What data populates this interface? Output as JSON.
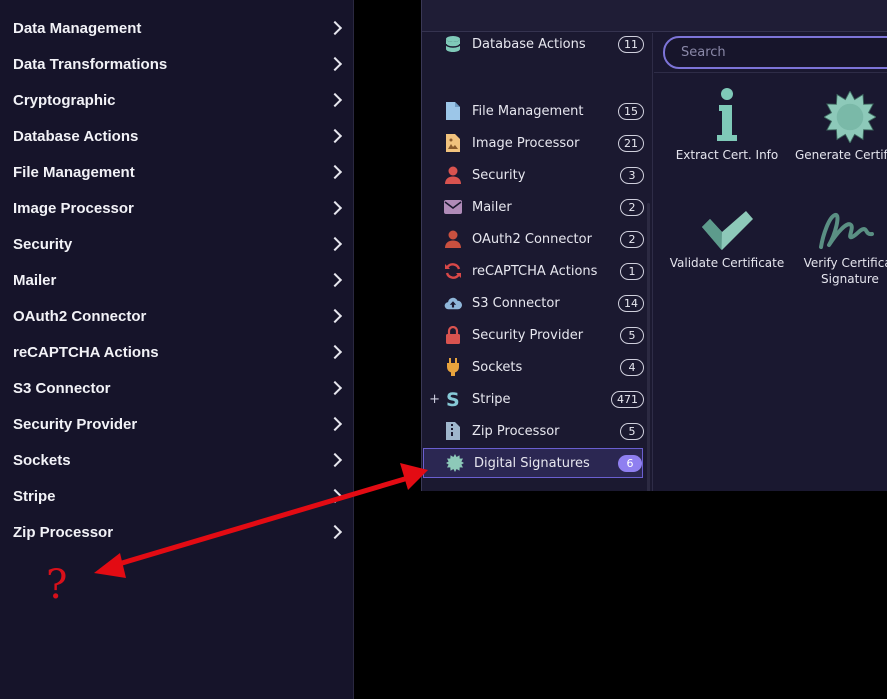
{
  "left_menu": {
    "items": [
      {
        "label": "Data Management"
      },
      {
        "label": "Data Transformations"
      },
      {
        "label": "Cryptographic"
      },
      {
        "label": "Database Actions"
      },
      {
        "label": "File Management"
      },
      {
        "label": "Image Processor"
      },
      {
        "label": "Security"
      },
      {
        "label": "Mailer"
      },
      {
        "label": "OAuth2 Connector"
      },
      {
        "label": "reCAPTCHA Actions"
      },
      {
        "label": "S3 Connector"
      },
      {
        "label": "Security Provider"
      },
      {
        "label": "Sockets"
      },
      {
        "label": "Stripe"
      },
      {
        "label": "Zip Processor"
      }
    ],
    "annotation": "?"
  },
  "category_list": {
    "items": [
      {
        "label": "Database Actions",
        "count": "11",
        "icon": "database-icon"
      },
      {
        "label": "File Management",
        "count": "15",
        "icon": "file-icon"
      },
      {
        "label": "Image Processor",
        "count": "21",
        "icon": "image-file-icon"
      },
      {
        "label": "Security",
        "count": "3",
        "icon": "user-icon"
      },
      {
        "label": "Mailer",
        "count": "2",
        "icon": "mail-icon"
      },
      {
        "label": "OAuth2 Connector",
        "count": "2",
        "icon": "user-icon"
      },
      {
        "label": "reCAPTCHA Actions",
        "count": "1",
        "icon": "refresh-icon"
      },
      {
        "label": "S3 Connector",
        "count": "14",
        "icon": "cloud-upload-icon"
      },
      {
        "label": "Security Provider",
        "count": "5",
        "icon": "lock-icon"
      },
      {
        "label": "Sockets",
        "count": "4",
        "icon": "plug-icon"
      },
      {
        "label": "Stripe",
        "count": "471",
        "icon": "stripe-s-icon",
        "expand": "+"
      },
      {
        "label": "Zip Processor",
        "count": "5",
        "icon": "zip-file-icon"
      },
      {
        "label": "Digital Signatures",
        "count": "6",
        "icon": "seal-icon",
        "selected": true
      }
    ]
  },
  "search": {
    "placeholder": "Search"
  },
  "actions": [
    {
      "label": "Extract Cert. Info",
      "icon": "info-icon"
    },
    {
      "label": "Generate Certifica",
      "icon": "seal-icon"
    },
    {
      "label": "Validate Certificate",
      "icon": "checkmark-icon"
    },
    {
      "label": "Verify Certificat",
      "label2": "Signature",
      "icon": "signature-icon"
    }
  ],
  "colors": {
    "accent": "#8f7ff0",
    "arrow": "#e30b13",
    "teal": "#7fc9b8"
  }
}
